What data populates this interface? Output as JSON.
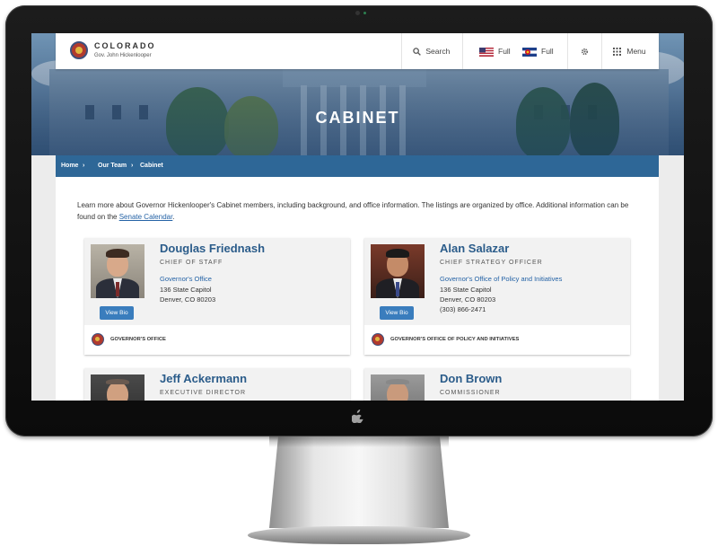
{
  "header": {
    "brand": "COLORADO",
    "brand_sub": "Gov. John Hickenlooper",
    "search_label": "Search",
    "lang_en_label": "Full",
    "lang_co_label": "Full",
    "menu_label": "Menu",
    "icons": [
      "search-icon",
      "us-flag-icon",
      "colorado-flag-icon",
      "gear-icon",
      "grid-menu-icon"
    ]
  },
  "hero": {
    "title": "CABINET"
  },
  "breadcrumb": {
    "items": [
      "Home",
      "Our Team",
      "Cabinet"
    ],
    "separator": "›"
  },
  "intro": {
    "text_before": "Learn more about Governor Hickenlooper's Cabinet members, including background, and office information. The listings are organized by office. Additional information can be found on the ",
    "link": "Senate Calendar",
    "text_after": "."
  },
  "cards": [
    {
      "name": "Douglas Friednash",
      "title": "CHIEF OF STAFF",
      "office": "Governor's Office",
      "address_lines": [
        "136 State Capitol",
        "Denver, CO 80203"
      ],
      "button": "View Bio",
      "footer": "GOVERNOR'S OFFICE"
    },
    {
      "name": "Alan Salazar",
      "title": "CHIEF STRATEGY OFFICER",
      "office": "Governor's Office of Policy and Initiatives",
      "address_lines": [
        "136 State Capitol",
        "Denver, CO 80203",
        "(303) 866-2471"
      ],
      "button": "View Bio",
      "footer": "GOVERNOR'S OFFICE OF POLICY AND INITIATIVES"
    },
    {
      "name": "Jeff Ackermann",
      "title": "EXECUTIVE DIRECTOR"
    },
    {
      "name": "Don Brown",
      "title": "COMMISSIONER"
    }
  ],
  "colors": {
    "link_blue": "#2563a6",
    "name_blue": "#2b5c8a",
    "breadcrumb_bg": "#2e6797",
    "button_bg": "#3a7dbd"
  }
}
